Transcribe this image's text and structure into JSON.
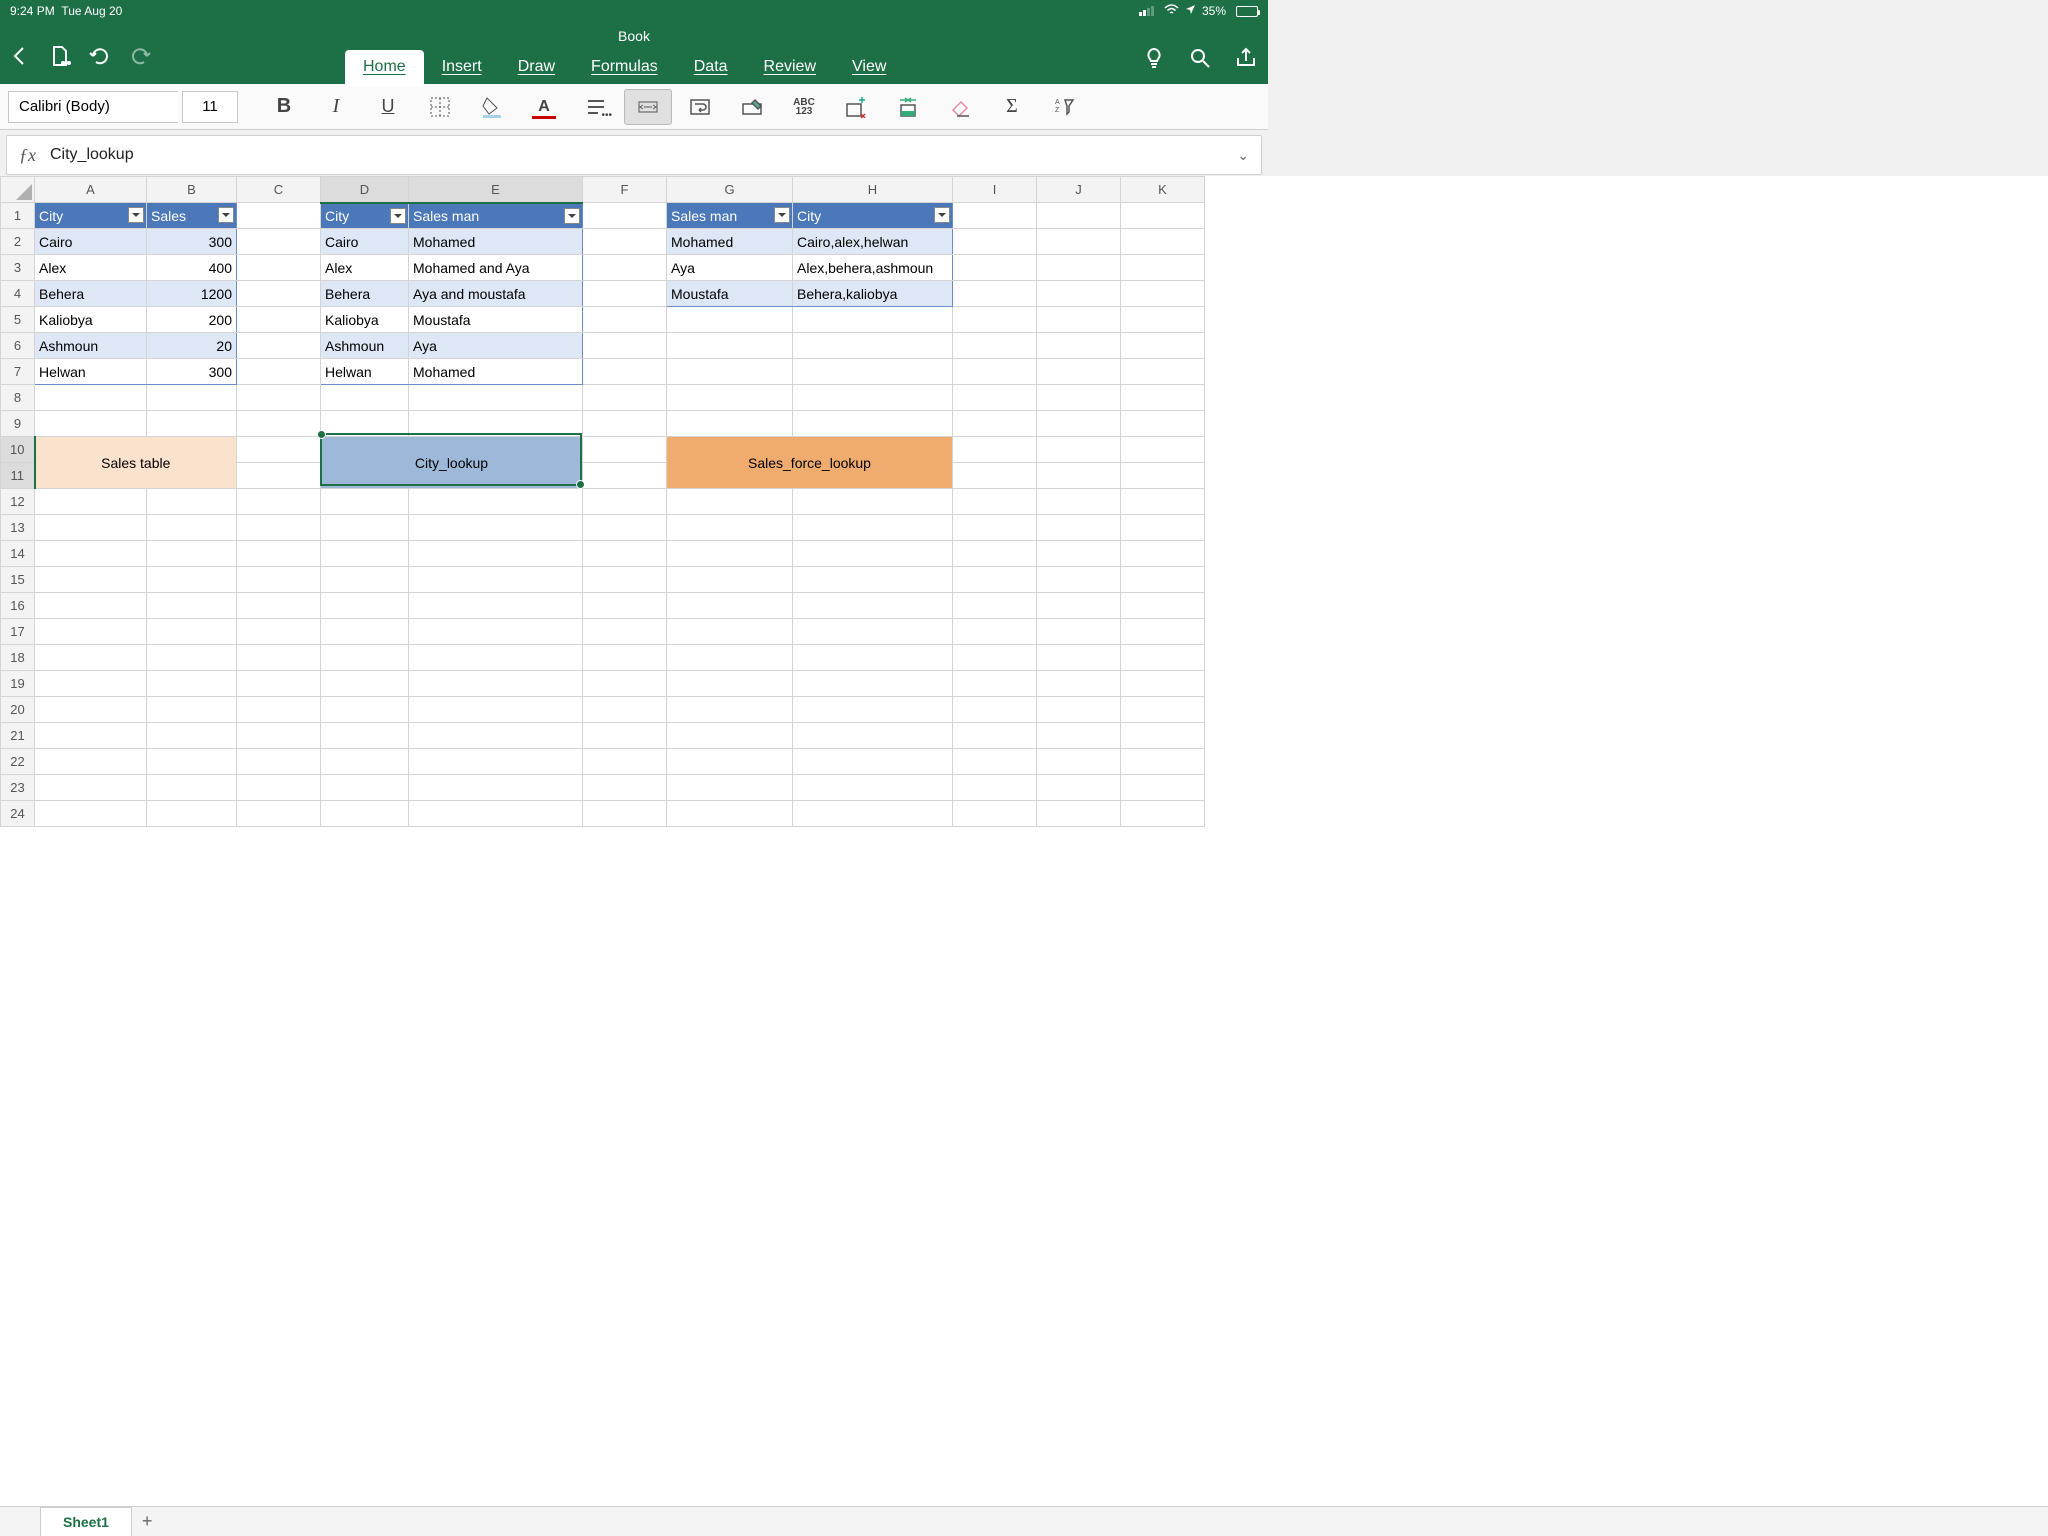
{
  "status": {
    "time": "9:24 PM",
    "date": "Tue Aug 20",
    "battery_pct": "35%"
  },
  "doc": {
    "title": "Book"
  },
  "tabs": {
    "home": "Home",
    "insert": "Insert",
    "draw": "Draw",
    "formulas": "Formulas",
    "data": "Data",
    "review": "Review",
    "view": "View"
  },
  "fmt": {
    "font": "Calibri (Body)",
    "size": "11",
    "abc": "ABC",
    "n123": "123"
  },
  "fx": {
    "label": "ƒx",
    "value": "City_lookup"
  },
  "cols": [
    "A",
    "B",
    "C",
    "D",
    "E",
    "F",
    "G",
    "H",
    "I",
    "J",
    "K"
  ],
  "rows": [
    "1",
    "2",
    "3",
    "4",
    "5",
    "6",
    "7",
    "8",
    "9",
    "10",
    "11",
    "12",
    "13",
    "14",
    "15",
    "16",
    "17",
    "18",
    "19",
    "20",
    "21",
    "22",
    "23",
    "24"
  ],
  "t1": {
    "h1": "City",
    "h2": "Sales",
    "r": [
      {
        "a": "Cairo",
        "b": "300"
      },
      {
        "a": "Alex",
        "b": "400"
      },
      {
        "a": "Behera",
        "b": "1200"
      },
      {
        "a": "Kaliobya",
        "b": "200"
      },
      {
        "a": "Ashmoun",
        "b": "20"
      },
      {
        "a": "Helwan",
        "b": "300"
      }
    ]
  },
  "t2": {
    "h1": "City",
    "h2": "Sales man",
    "r": [
      {
        "a": "Cairo",
        "b": "Mohamed"
      },
      {
        "a": "Alex",
        "b": "Mohamed and Aya"
      },
      {
        "a": "Behera",
        "b": "Aya and moustafa"
      },
      {
        "a": "Kaliobya",
        "b": "Moustafa"
      },
      {
        "a": "Ashmoun",
        "b": "Aya"
      },
      {
        "a": "Helwan",
        "b": "Mohamed"
      }
    ]
  },
  "t3": {
    "h1": "Sales man",
    "h2": "City",
    "r": [
      {
        "a": "Mohamed",
        "b": "Cairo,alex,helwan"
      },
      {
        "a": "Aya",
        "b": "Alex,behera,ashmoun"
      },
      {
        "a": "Moustafa",
        "b": "Behera,kaliobya"
      }
    ]
  },
  "labels": {
    "l1": "Sales table",
    "l2": "City_lookup",
    "l3": "Sales_force_lookup"
  },
  "sheet": {
    "name": "Sheet1"
  }
}
